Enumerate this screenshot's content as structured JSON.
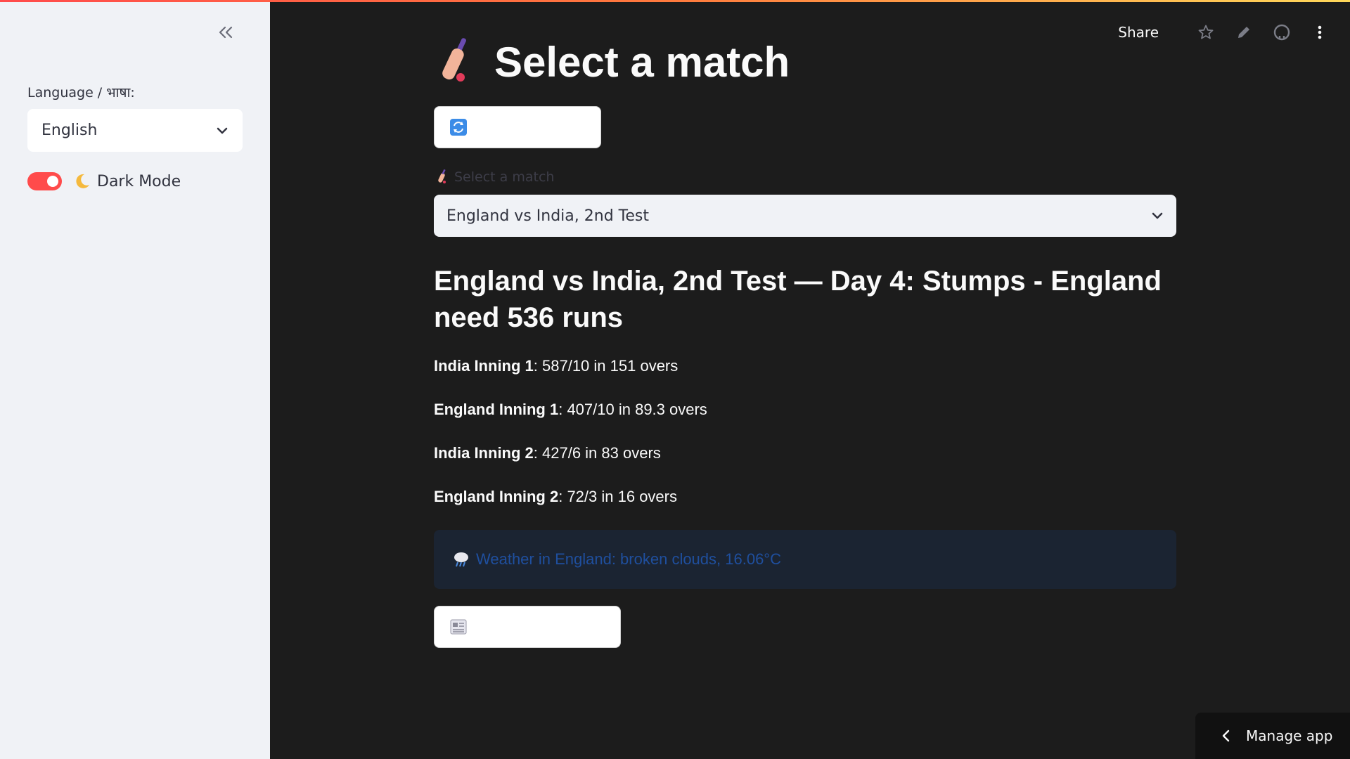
{
  "sidebar": {
    "collapse_icon": "double-chevron-left-icon",
    "language_label": "Language / भाषा:",
    "language_value": "English",
    "dark_mode_label": "Dark Mode",
    "dark_mode_on": true,
    "toggle_color": "#ff4b4b"
  },
  "header": {
    "share_label": "Share",
    "icons": [
      "star-icon",
      "pencil-icon",
      "github-icon",
      "more-vertical-icon"
    ]
  },
  "main": {
    "title": "Select a match",
    "title_icon": "cricket-bat-icon",
    "refresh_button_icon": "refresh-icon",
    "select_label": "Select a match",
    "selected_match": "England vs India, 2nd Test",
    "match_heading": "England vs India, 2nd Test — Day 4: Stumps - England need 536 runs",
    "innings": [
      {
        "label": "India Inning 1",
        "score": ": 587/10 in 151 overs"
      },
      {
        "label": "England Inning 1",
        "score": ": 407/10 in 89.3 overs"
      },
      {
        "label": "India Inning 2",
        "score": ": 427/6 in 83 overs"
      },
      {
        "label": "England Inning 2",
        "score": ": 72/3 in 16 overs"
      }
    ],
    "weather_text": "Weather in England: broken clouds, 16.06°C",
    "weather_icon": "rain-cloud-icon",
    "news_button_icon": "newspaper-icon"
  },
  "footer": {
    "manage_app_label": "Manage app"
  },
  "colors": {
    "main_bg": "#1c1c1c",
    "sidebar_bg": "#f0f2f6",
    "accent": "#ff4b4b",
    "weather_bg": "#1b2432",
    "weather_text": "#1f4f9e"
  }
}
